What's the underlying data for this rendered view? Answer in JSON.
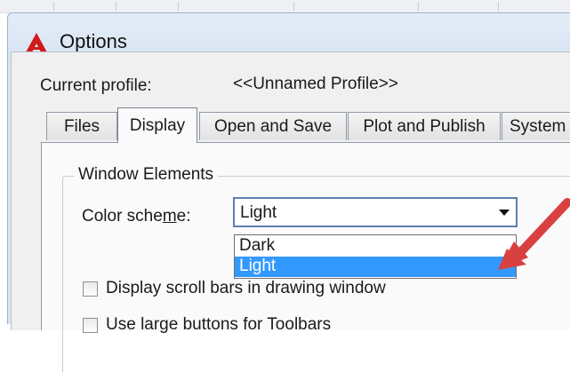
{
  "window": {
    "title": "Options",
    "app_icon": "autocad-a-icon",
    "brand_color": "#d11a1a"
  },
  "profile": {
    "label": "Current profile:",
    "value": "<<Unnamed Profile>>"
  },
  "tabs": [
    {
      "label": "Files",
      "active": false
    },
    {
      "label": "Display",
      "active": true
    },
    {
      "label": "Open and Save",
      "active": false
    },
    {
      "label": "Plot and Publish",
      "active": false
    },
    {
      "label": "System",
      "active": false
    }
  ],
  "window_elements": {
    "group_title": "Window Elements",
    "color_scheme": {
      "label_pre": "Color sche",
      "label_u": "m",
      "label_post": "e:",
      "selected": "Light",
      "options": [
        "Dark",
        "Light"
      ],
      "highlighted": "Light",
      "highlight_color": "#3399ff"
    },
    "checkboxes": [
      {
        "label": "Display scroll bars in drawing window",
        "checked": false
      },
      {
        "label": "Use large buttons for Toolbars",
        "checked": false
      }
    ]
  },
  "annotation": {
    "arrow_icon": "red-pointer-arrow",
    "color": "#d94141"
  }
}
